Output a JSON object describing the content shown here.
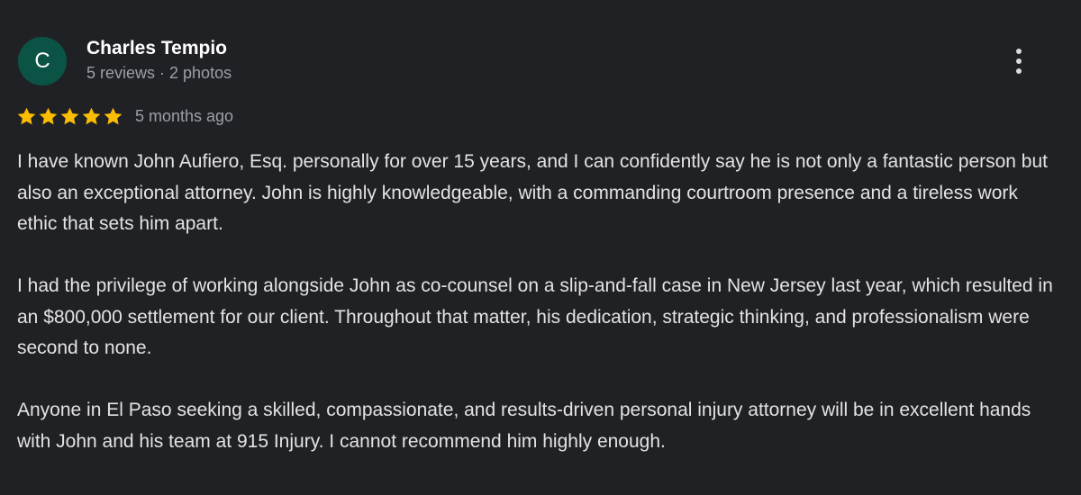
{
  "review": {
    "author": {
      "initial": "C",
      "name": "Charles Tempio",
      "meta": "5 reviews · 2 photos"
    },
    "rating": {
      "stars": 5,
      "max": 5,
      "star_color": "#fbbc04"
    },
    "date": "5 months ago",
    "paragraphs": [
      "I have known John Aufiero, Esq. personally for over 15 years, and I can confidently say he is not only a fantastic person but also an exceptional attorney. John is highly knowledgeable, with a commanding courtroom presence and a tireless work ethic that sets him apart.",
      "I had the privilege of working alongside John as co-counsel on a slip-and-fall case in New Jersey last year, which resulted in an $800,000 settlement for our client. Throughout that matter, his dedication, strategic thinking, and professionalism were second to none.",
      "Anyone in El Paso seeking a skilled, compassionate, and results-driven personal injury attorney will be in excellent hands with John and his team at 915 Injury. I cannot recommend him highly enough."
    ],
    "more_icon": "more-vert-icon"
  },
  "colors": {
    "background": "#202124",
    "avatar": "#0b5345",
    "text": "#e3e3e3",
    "muted": "#9aa0a6"
  }
}
